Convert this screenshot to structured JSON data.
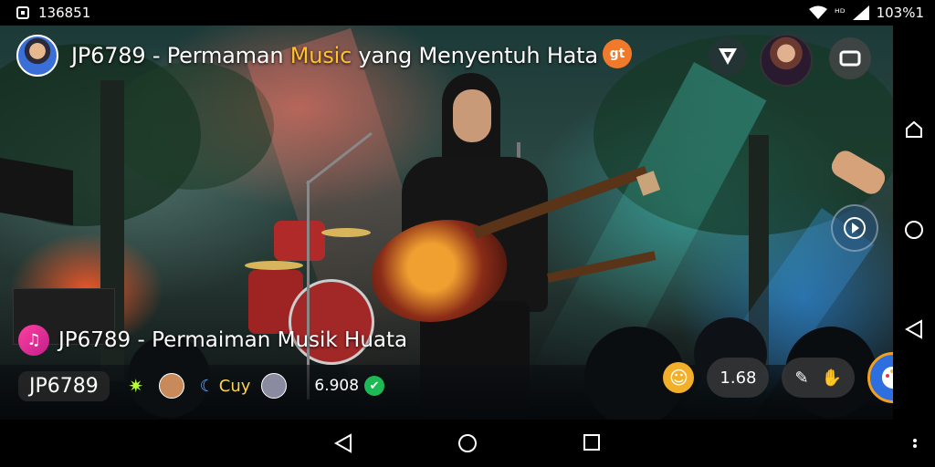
{
  "status_bar": {
    "time": "136851",
    "network_label": "ᴴᴰ",
    "battery": "103%1"
  },
  "header": {
    "title_prefix": "JP6789 - Permaman ",
    "title_highlight": "Music",
    "title_suffix": " yang Menyentuh Hata",
    "orange_badge": "gt"
  },
  "overlay": {
    "sub_title": "JP6789 - Permaiman Musik Huata",
    "channel_name": "JP6789",
    "gift_label": "Cuy",
    "viewer_count": "6.908",
    "likes_count": "1.68"
  },
  "colors": {
    "accent_orange": "#f07a2a",
    "highlight_yellow": "#ffc22e",
    "music_badge": "#e0308f",
    "live_green": "#1db954",
    "brush_blue": "#2e6fe0"
  },
  "icons": {
    "top_right": [
      "vpn-shield-icon",
      "avatar-icon",
      "screen-cast-icon"
    ],
    "side_nav": [
      "home-icon",
      "circle-icon",
      "back-icon"
    ],
    "bottom_nav": [
      "back-icon",
      "home-icon",
      "recents-icon",
      "more-icon"
    ]
  }
}
